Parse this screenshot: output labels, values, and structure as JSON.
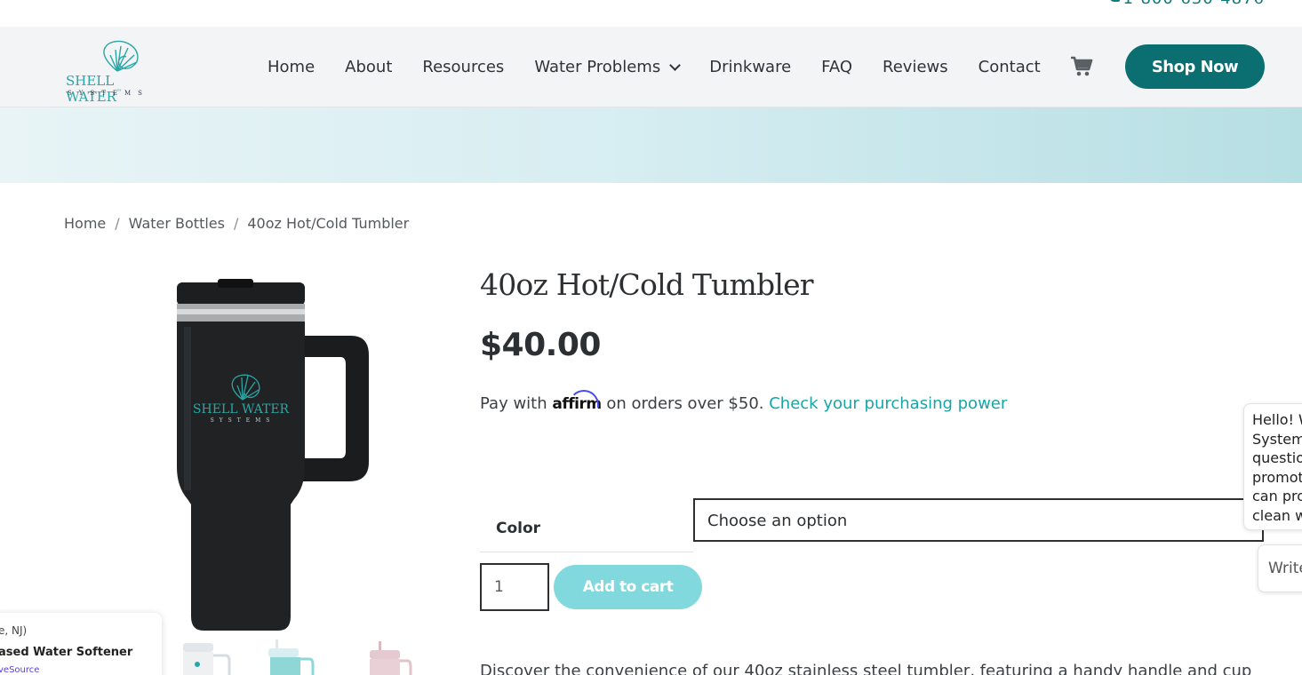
{
  "topbar": {
    "phone": "1-800-630-4876"
  },
  "header": {
    "logo": {
      "name": "SHELL WATER",
      "tm": "™",
      "sub": "SYSTEMS"
    },
    "nav": [
      "Home",
      "About",
      "Resources",
      "Water Problems",
      "Drinkware",
      "FAQ",
      "Reviews",
      "Contact"
    ],
    "cart_icon": "shopping-cart-icon",
    "shop_now": "Shop Now"
  },
  "breadcrumb": {
    "items": [
      "Home",
      "Water Bottles",
      "40oz Hot/Cold Tumbler"
    ],
    "separator": "/"
  },
  "product": {
    "image_logo": {
      "name": "SHELL WATER",
      "sub": "SYSTEMS"
    },
    "title": "40oz Hot/Cold Tumbler",
    "price": "$40.00",
    "affirm": {
      "prefix": "Pay with",
      "brand": "affirm",
      "suffix": "on orders over $50.",
      "link": "Check your purchasing power"
    },
    "color_label": "Color",
    "color_select": "Choose an option",
    "quantity": "1",
    "add_to_cart": "Add to cart",
    "description": "Discover the convenience of our 40oz stainless steel tumbler, featuring a handy handle and cup"
  },
  "chat": {
    "lines": [
      "Hello! W",
      "Systems",
      "questio",
      "promot",
      "can pro",
      "clean w"
    ],
    "input_placeholder": "Write"
  },
  "recent_purchase_popup": {
    "location": "e, NJ)",
    "product": "ased Water Softener",
    "source": "veSource"
  },
  "colors": {
    "brand_teal": "#0b6f71",
    "accent_teal": "#17a6a6",
    "add_to_cart_disabled": "#82d9dd",
    "affirm_arc": "#4a4af4"
  }
}
